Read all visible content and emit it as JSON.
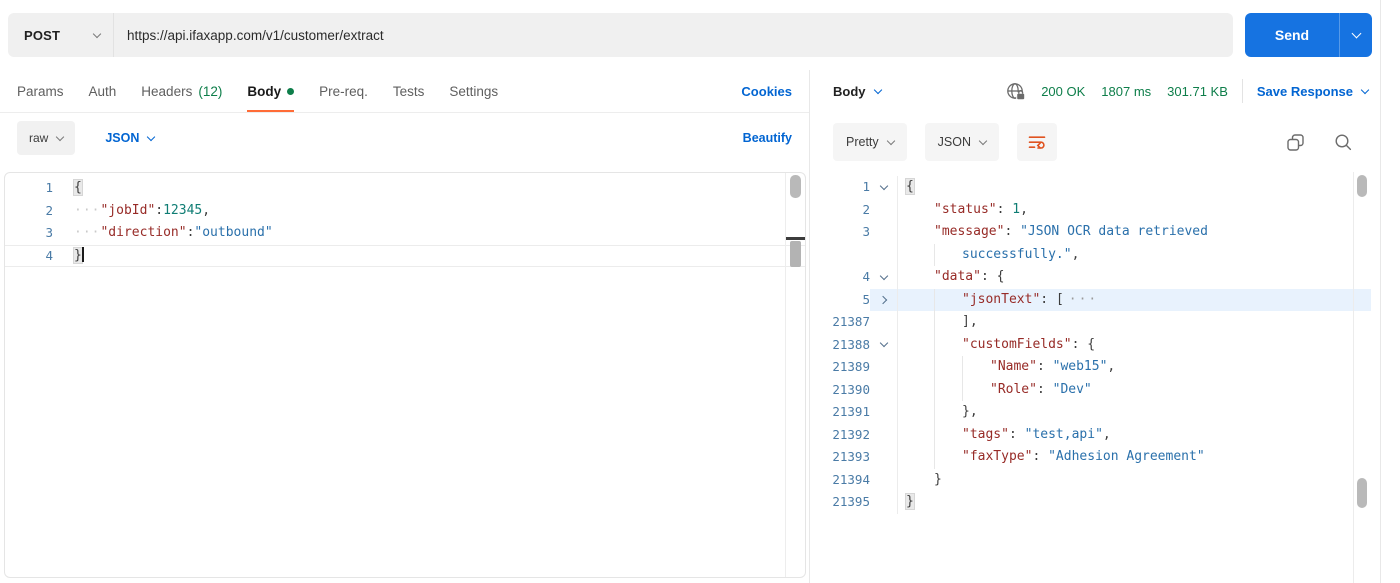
{
  "request_bar": {
    "method": "POST",
    "url": "https://api.ifaxapp.com/v1/customer/extract",
    "send_label": "Send"
  },
  "request_tabs": {
    "tabs": [
      {
        "label": "Params"
      },
      {
        "label": "Auth"
      },
      {
        "label": "Headers",
        "count": "(12)"
      },
      {
        "label": "Body",
        "active": true,
        "has_dot": true
      },
      {
        "label": "Pre-req."
      },
      {
        "label": "Tests"
      },
      {
        "label": "Settings"
      }
    ],
    "cookies_link": "Cookies"
  },
  "body_toolbar": {
    "body_type": "raw",
    "language": "JSON",
    "beautify_link": "Beautify"
  },
  "request_editor": {
    "rows": [
      {
        "num": "1",
        "segs": [
          {
            "t": "brace",
            "v": "{",
            "match": true
          }
        ]
      },
      {
        "num": "2",
        "segs": [
          {
            "t": "dots",
            "v": "···"
          },
          {
            "t": "key",
            "v": "\"jobId\""
          },
          {
            "t": "punc",
            "v": ":"
          },
          {
            "t": "num",
            "v": "12345"
          },
          {
            "t": "punc",
            "v": ","
          }
        ]
      },
      {
        "num": "3",
        "segs": [
          {
            "t": "dots",
            "v": "···"
          },
          {
            "t": "key",
            "v": "\"direction\""
          },
          {
            "t": "punc",
            "v": ":"
          },
          {
            "t": "str",
            "v": "\"outbound\""
          }
        ]
      },
      {
        "num": "4",
        "active": true,
        "segs": [
          {
            "t": "brace",
            "v": "}",
            "match": true
          },
          {
            "t": "cursor"
          }
        ]
      }
    ]
  },
  "response_header": {
    "view": "Body",
    "status": "200 OK",
    "time": "1807 ms",
    "size": "301.71 KB",
    "save_label": "Save Response"
  },
  "response_toolbar": {
    "format": "Pretty",
    "language": "JSON"
  },
  "response_editor": {
    "rows": [
      {
        "num": "1",
        "fold": "open",
        "indent": 0,
        "segs": [
          {
            "t": "brace",
            "v": "{",
            "match": true
          }
        ]
      },
      {
        "num": "2",
        "indent": 1,
        "segs": [
          {
            "t": "key",
            "v": "\"status\""
          },
          {
            "t": "punc",
            "v": ": "
          },
          {
            "t": "num",
            "v": "1"
          },
          {
            "t": "punc",
            "v": ","
          }
        ]
      },
      {
        "num": "3",
        "indent": 1,
        "segs": [
          {
            "t": "key",
            "v": "\"message\""
          },
          {
            "t": "punc",
            "v": ": "
          },
          {
            "t": "str",
            "v": "\"JSON OCR data retrieved"
          }
        ]
      },
      {
        "num": "",
        "indent": 2,
        "segs": [
          {
            "t": "str",
            "v": "successfully.\""
          },
          {
            "t": "punc",
            "v": ","
          }
        ]
      },
      {
        "num": "4",
        "fold": "open",
        "indent": 1,
        "segs": [
          {
            "t": "key",
            "v": "\"data\""
          },
          {
            "t": "punc",
            "v": ": "
          },
          {
            "t": "brace",
            "v": "{"
          }
        ]
      },
      {
        "num": "5",
        "fold": "closed",
        "indent": 2,
        "hl": true,
        "segs": [
          {
            "t": "key",
            "v": "\"jsonText\""
          },
          {
            "t": "punc",
            "v": ": "
          },
          {
            "t": "brace",
            "v": "["
          },
          {
            "t": "ellipsis",
            "v": "···"
          }
        ]
      },
      {
        "num": "21387",
        "indent": 2,
        "segs": [
          {
            "t": "brace",
            "v": "]"
          },
          {
            "t": "punc",
            "v": ","
          }
        ]
      },
      {
        "num": "21388",
        "fold": "open",
        "indent": 2,
        "segs": [
          {
            "t": "key",
            "v": "\"customFields\""
          },
          {
            "t": "punc",
            "v": ": "
          },
          {
            "t": "brace",
            "v": "{"
          }
        ]
      },
      {
        "num": "21389",
        "indent": 3,
        "segs": [
          {
            "t": "key",
            "v": "\"Name\""
          },
          {
            "t": "punc",
            "v": ": "
          },
          {
            "t": "str",
            "v": "\"web15\""
          },
          {
            "t": "punc",
            "v": ","
          }
        ]
      },
      {
        "num": "21390",
        "indent": 3,
        "segs": [
          {
            "t": "key",
            "v": "\"Role\""
          },
          {
            "t": "punc",
            "v": ": "
          },
          {
            "t": "str",
            "v": "\"Dev\""
          }
        ]
      },
      {
        "num": "21391",
        "indent": 2,
        "segs": [
          {
            "t": "brace",
            "v": "}"
          },
          {
            "t": "punc",
            "v": ","
          }
        ]
      },
      {
        "num": "21392",
        "indent": 2,
        "segs": [
          {
            "t": "key",
            "v": "\"tags\""
          },
          {
            "t": "punc",
            "v": ": "
          },
          {
            "t": "str",
            "v": "\"test,api\""
          },
          {
            "t": "punc",
            "v": ","
          }
        ]
      },
      {
        "num": "21393",
        "indent": 2,
        "segs": [
          {
            "t": "key",
            "v": "\"faxType\""
          },
          {
            "t": "punc",
            "v": ": "
          },
          {
            "t": "str",
            "v": "\"Adhesion Agreement\""
          }
        ]
      },
      {
        "num": "21394",
        "indent": 1,
        "segs": [
          {
            "t": "brace",
            "v": "}"
          }
        ]
      },
      {
        "num": "21395",
        "indent": 0,
        "segs": [
          {
            "t": "brace",
            "v": "}",
            "match": true
          }
        ]
      }
    ]
  },
  "icons": {
    "method_caret": "chevron-down-icon",
    "send_caret": "chevron-down-icon",
    "network": "globe-lock-icon",
    "wrap": "wrap-line-icon",
    "copy": "copy-icon",
    "search": "search-icon"
  },
  "colors": {
    "accent_blue": "#0265d2",
    "send_blue": "#1673e1",
    "success_green": "#0e7e4a",
    "active_tab_underline": "#ff6c37",
    "json_key": "#972b27",
    "json_string": "#2a70ab",
    "json_number": "#0f7d74",
    "line_number": "#4a7ba6"
  }
}
